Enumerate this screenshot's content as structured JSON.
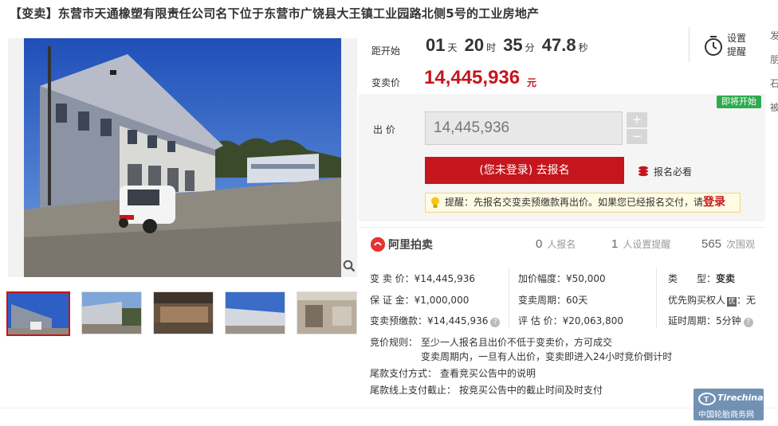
{
  "title": "【变卖】东营市天通橡塑有限责任公司名下位于东营市广饶县大王镇工业园路北侧5号的工业房地产",
  "right_edge": [
    "发",
    "朋",
    "石",
    "被"
  ],
  "countdown": {
    "label": "距开始",
    "days": "01",
    "days_unit": "天",
    "hours": "20",
    "hours_unit": "时",
    "minutes": "35",
    "minutes_unit": "分",
    "seconds": "47.8",
    "seconds_unit": "秒"
  },
  "remind": {
    "line1": "设置",
    "line2": "提醒"
  },
  "price": {
    "label": "变卖价",
    "value": "14,445,936",
    "unit": "元"
  },
  "bid": {
    "badge": "即将开始",
    "label": "出 价",
    "value": "14,445,936",
    "plus": "+",
    "minus": "−",
    "signup": "(您未登录) 去报名",
    "must_read": "报名必看",
    "tip_text": "提醒：先报名交变卖预缴款再出价。如果您已经报名交付，请",
    "tip_login": "登录"
  },
  "stats": {
    "brand": "阿里拍卖",
    "signup_count": "0",
    "signup_label": "人报名",
    "remind_count": "1",
    "remind_label": "人设置提醒",
    "view_count": "565",
    "view_label": "次围观"
  },
  "info": {
    "c1": [
      "变 卖 价：¥14,445,936",
      "保 证 金：¥1,000,000",
      "变卖预缴款：¥14,445,936"
    ],
    "c2": [
      "加价幅度：¥50,000",
      "变卖周期：60天",
      "评 估 价：¥20,063,800"
    ],
    "c3": [
      "类　　型：",
      "优先购买权人",
      "延时周期：5分钟"
    ],
    "c3_type_value": "变卖",
    "c3_pri_badge": "优",
    "c3_pri_value": "：无",
    "rule_label": "竞价规则：",
    "rule_line1": "至少一人报名且出价不低于变卖价，方可成交",
    "rule_line2": "变卖周期内，一旦有人出价，变卖即进入24小时竞价倒计时",
    "pay_label": "尾款支付方式：",
    "pay_value": "查看竞买公告中的说明",
    "deadline_label": "尾款线上支付截止：",
    "deadline_value": "按竞买公告中的截止时间及时支付"
  },
  "watermark": {
    "line1": "Tirechina",
    "line2": "中国轮胎商务网"
  },
  "colors": {
    "accent": "#c4161c",
    "badge": "#2eab4f",
    "tip_bg": "#fffbe2"
  }
}
